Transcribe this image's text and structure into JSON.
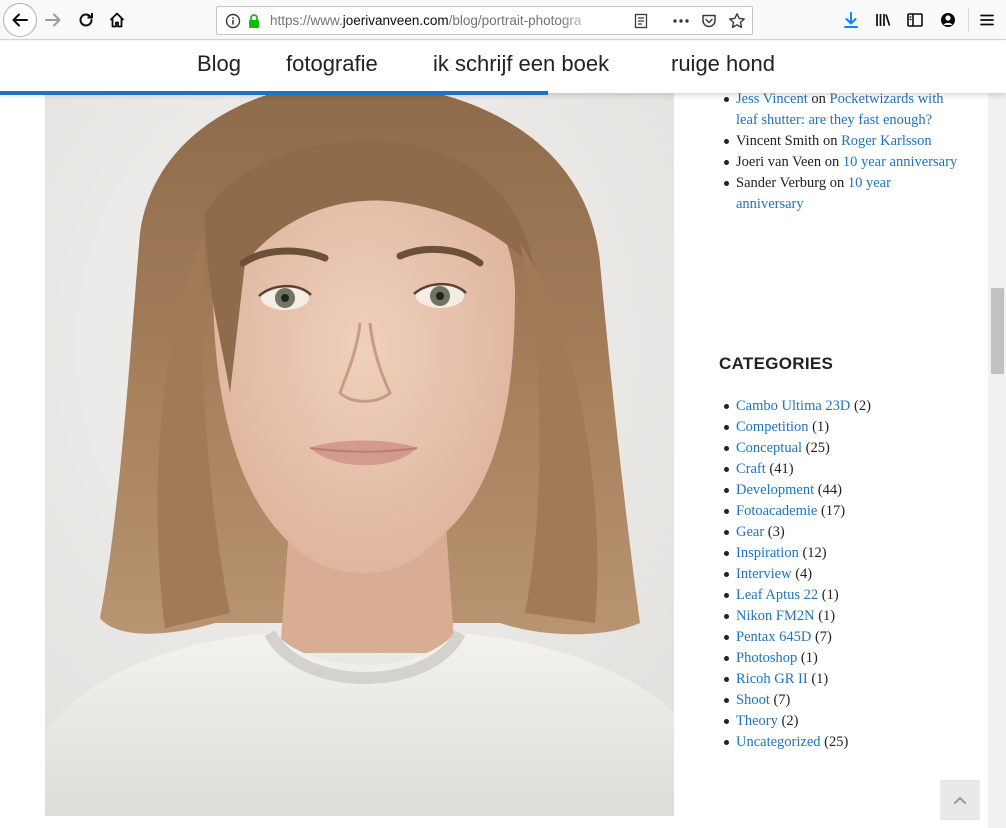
{
  "browser": {
    "url_prefix": "https://www.",
    "url_domain": "joerivanveen.com",
    "url_path": "/blog/portrait-photogra"
  },
  "nav": {
    "items": [
      "Blog",
      "fotografie",
      "ik schrijf een boek",
      "ruige hond"
    ],
    "accent_color": "#1e73be"
  },
  "recent_comments": [
    {
      "author": "Jess Vincent",
      "author_is_link": true,
      "on": "on",
      "post": "Pocketwizards with leaf shutter: are they fast enough?"
    },
    {
      "author": "Vincent Smith",
      "author_is_link": false,
      "on": "on",
      "post": "Roger Karlsson"
    },
    {
      "author": "Joeri van Veen",
      "author_is_link": false,
      "on": "on",
      "post": "10 year anniversary"
    },
    {
      "author": "Sander Verburg",
      "author_is_link": false,
      "on": "on",
      "post": "10 year anniversary"
    }
  ],
  "categories": {
    "title": "CATEGORIES",
    "items": [
      {
        "name": "Cambo Ultima 23D",
        "count": "(2)"
      },
      {
        "name": "Competition",
        "count": "(1)"
      },
      {
        "name": "Conceptual",
        "count": "(25)"
      },
      {
        "name": "Craft",
        "count": "(41)"
      },
      {
        "name": "Development",
        "count": "(44)"
      },
      {
        "name": "Fotoacademie",
        "count": "(17)"
      },
      {
        "name": "Gear",
        "count": "(3)"
      },
      {
        "name": "Inspiration",
        "count": "(12)"
      },
      {
        "name": "Interview",
        "count": "(4)"
      },
      {
        "name": "Leaf Aptus 22",
        "count": "(1)"
      },
      {
        "name": "Nikon FM2N",
        "count": "(1)"
      },
      {
        "name": "Pentax 645D",
        "count": "(7)"
      },
      {
        "name": "Photoshop",
        "count": "(1)"
      },
      {
        "name": "Ricoh GR II",
        "count": "(1)"
      },
      {
        "name": "Shoot",
        "count": "(7)"
      },
      {
        "name": "Theory",
        "count": "(2)"
      },
      {
        "name": "Uncategorized",
        "count": "(25)"
      }
    ]
  },
  "reading_progress": 0.545,
  "icons": [
    "back-arrow-icon",
    "forward-arrow-icon",
    "reload-icon",
    "home-icon",
    "info-icon",
    "lock-icon",
    "reader-view-icon",
    "more-actions-icon",
    "pocket-icon",
    "bookmark-star-icon",
    "download-icon",
    "library-icon",
    "sidebar-icon",
    "account-icon",
    "menu-icon",
    "chevron-up-icon"
  ]
}
